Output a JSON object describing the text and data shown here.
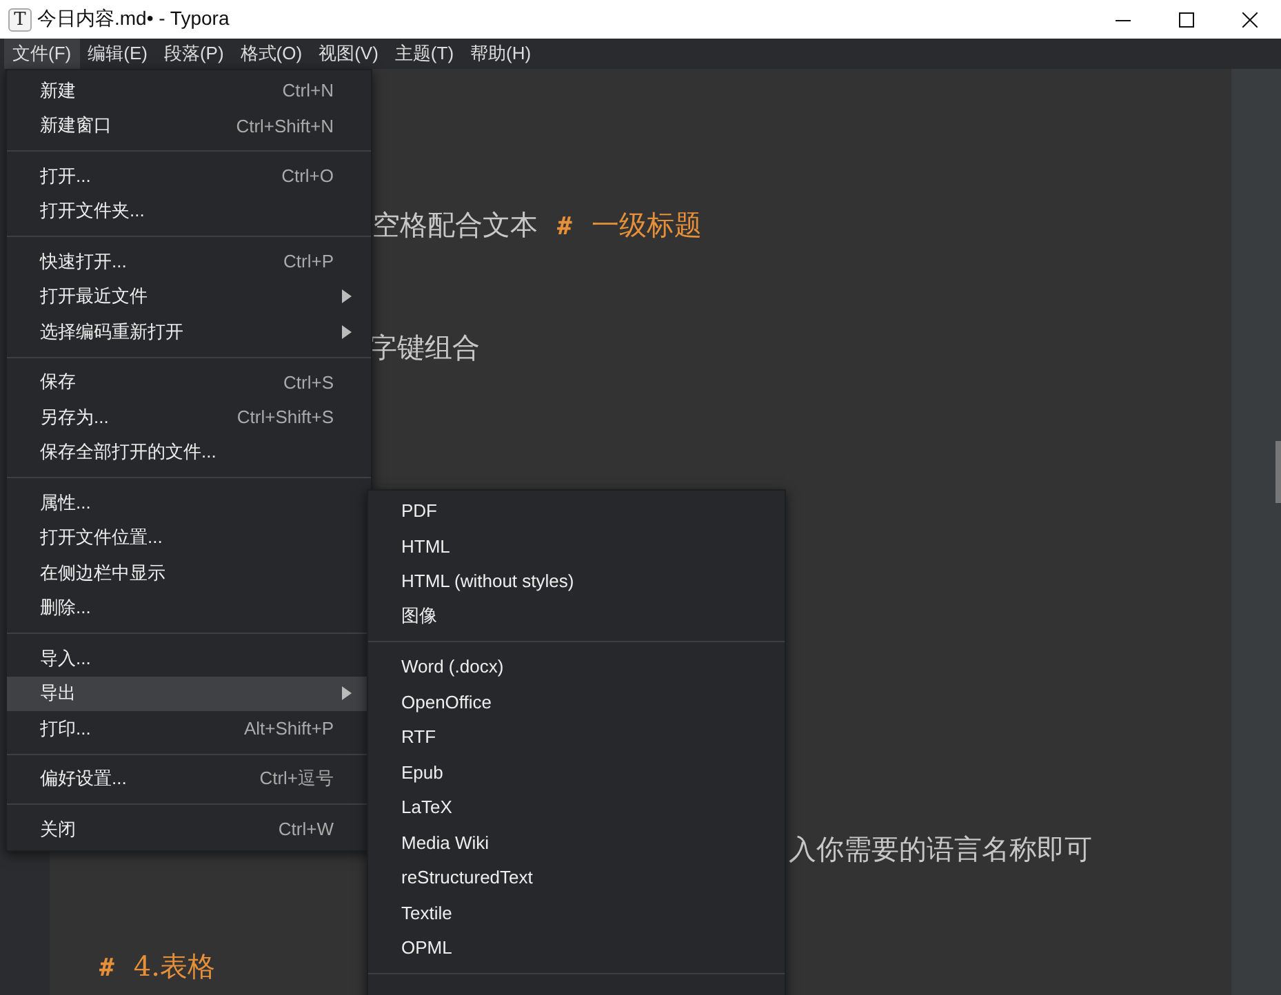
{
  "window": {
    "title": "今日内容.md• - Typora",
    "app_icon": "T"
  },
  "menubar": [
    {
      "label": "文件(F)",
      "selected": true
    },
    {
      "label": "编辑(E)",
      "selected": false
    },
    {
      "label": "段落(P)",
      "selected": false
    },
    {
      "label": "格式(O)",
      "selected": false
    },
    {
      "label": "视图(V)",
      "selected": false
    },
    {
      "label": "主题(T)",
      "selected": false
    },
    {
      "label": "帮助(H)",
      "selected": false
    }
  ],
  "file_menu": [
    [
      {
        "label": "新建",
        "shortcut": "Ctrl+N",
        "has_submenu": false,
        "selected": false
      },
      {
        "label": "新建窗口",
        "shortcut": "Ctrl+Shift+N",
        "has_submenu": false,
        "selected": false
      }
    ],
    [
      {
        "label": "打开...",
        "shortcut": "Ctrl+O",
        "has_submenu": false,
        "selected": false
      },
      {
        "label": "打开文件夹...",
        "has_submenu": false,
        "selected": false
      }
    ],
    [
      {
        "label": "快速打开...",
        "shortcut": "Ctrl+P",
        "has_submenu": false,
        "selected": false
      },
      {
        "label": "打开最近文件",
        "has_submenu": true,
        "selected": false
      },
      {
        "label": "选择编码重新打开",
        "has_submenu": true,
        "selected": false
      }
    ],
    [
      {
        "label": "保存",
        "shortcut": "Ctrl+S",
        "has_submenu": false,
        "selected": false
      },
      {
        "label": "另存为...",
        "shortcut": "Ctrl+Shift+S",
        "has_submenu": false,
        "selected": false
      },
      {
        "label": "保存全部打开的文件...",
        "has_submenu": false,
        "selected": false
      }
    ],
    [
      {
        "label": "属性...",
        "has_submenu": false,
        "selected": false
      },
      {
        "label": "打开文件位置...",
        "has_submenu": false,
        "selected": false
      },
      {
        "label": "在侧边栏中显示",
        "has_submenu": false,
        "selected": false
      },
      {
        "label": "删除...",
        "has_submenu": false,
        "selected": false
      }
    ],
    [
      {
        "label": "导入...",
        "has_submenu": false,
        "selected": false
      },
      {
        "label": "导出",
        "has_submenu": true,
        "selected": true
      },
      {
        "label": "打印...",
        "shortcut": "Alt+Shift+P",
        "has_submenu": false,
        "selected": false
      }
    ],
    [
      {
        "label": "偏好设置...",
        "shortcut": "Ctrl+逗号",
        "has_submenu": false,
        "selected": false
      }
    ],
    [
      {
        "label": "关闭",
        "shortcut": "Ctrl+W",
        "has_submenu": false,
        "selected": false
      }
    ]
  ],
  "export_menu": [
    [
      "PDF",
      "HTML",
      "HTML (without styles)",
      "图像"
    ],
    [
      "Word (.docx)",
      "OpenOffice",
      "RTF",
      "Epub",
      "LaTeX",
      "Media Wiki",
      "reStructuredText",
      "Textile",
      "OPML"
    ]
  ],
  "editor": {
    "lines": [
      {
        "segments": [
          {
            "kind": "plain",
            "text": "空格配合文本"
          },
          {
            "kind": "marker",
            "text": "#"
          },
          {
            "kind": "heading",
            "text": "一级标题"
          }
        ]
      },
      {
        "segments": [
          {
            "kind": "plain",
            "text": "字键组合"
          }
        ]
      },
      {
        "segments": [
          {
            "kind": "plain",
            "text": "入你需要的语言名称即可"
          }
        ]
      },
      {
        "segments": [
          {
            "kind": "marker",
            "text": "#"
          },
          {
            "kind": "heading",
            "text": "4.表格"
          }
        ]
      }
    ]
  }
}
